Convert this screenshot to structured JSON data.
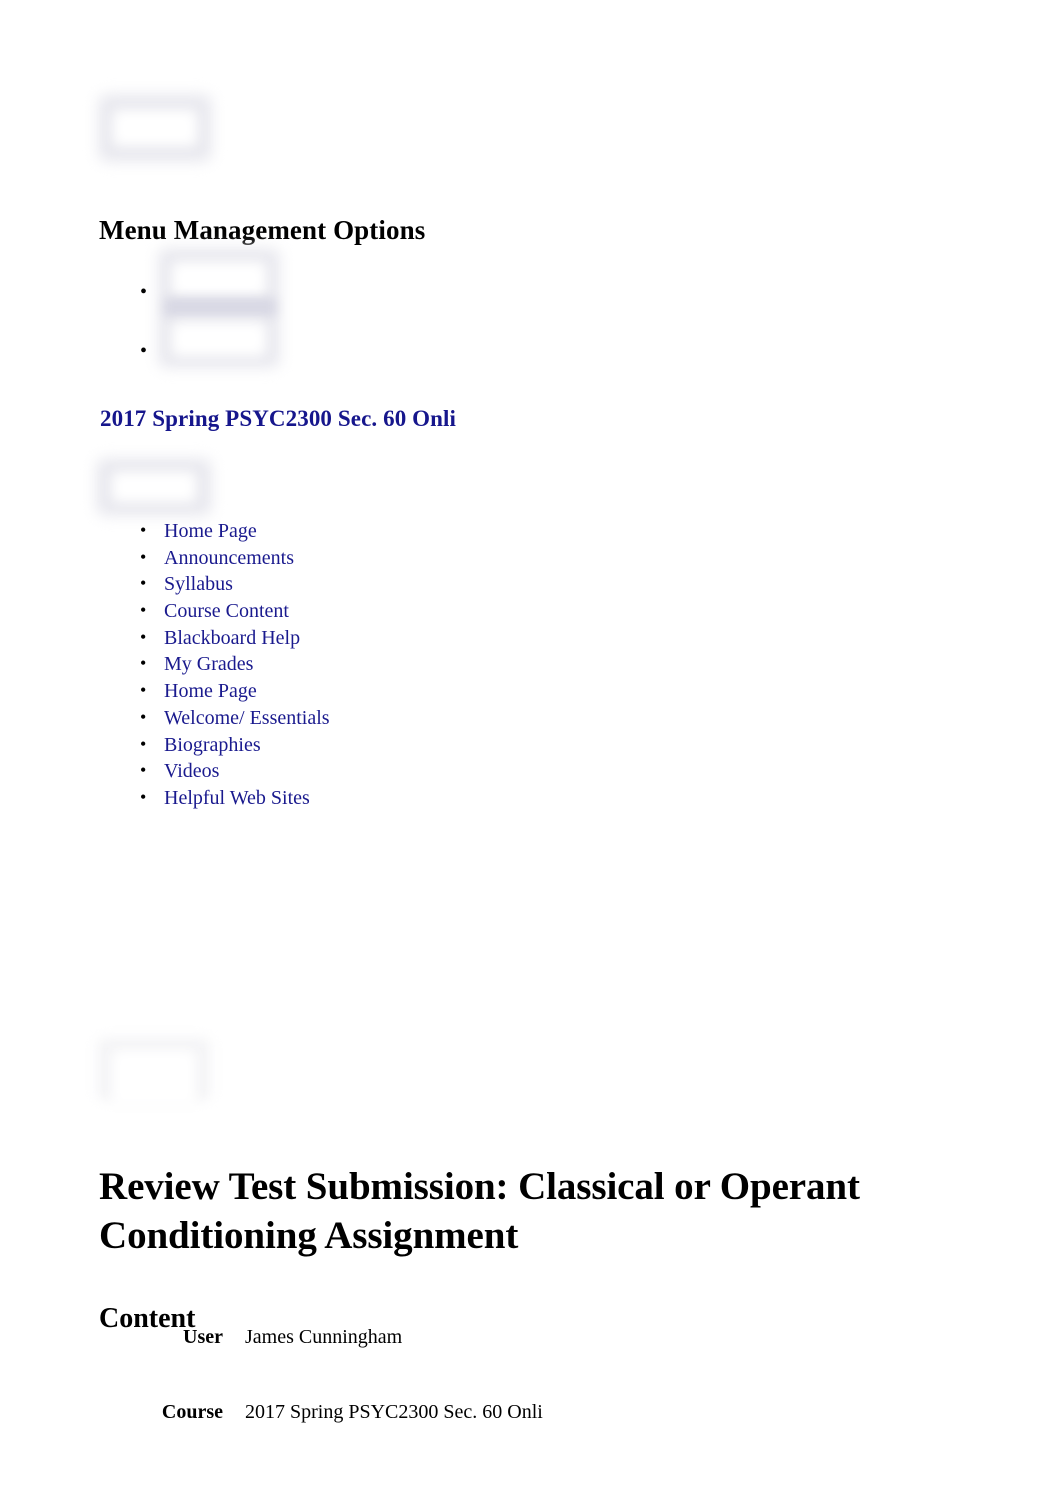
{
  "placeholders": {
    "top_block": "blurred-placeholder",
    "mid_block": "blurred-placeholder",
    "nav_block": "blurred-placeholder",
    "low_block": "blurred-placeholder"
  },
  "menu_section": {
    "heading": "Menu Management Options",
    "empty_items": [
      "",
      ""
    ]
  },
  "course": {
    "title_link": "2017 Spring PSYC2300 Sec. 60 Onli",
    "link_color": "#16168c"
  },
  "nav": {
    "link_color": "#1a1a8e",
    "items": [
      {
        "label": "Home Page"
      },
      {
        "label": "Announcements"
      },
      {
        "label": "Syllabus"
      },
      {
        "label": "Course Content"
      },
      {
        "label": "Blackboard Help"
      },
      {
        "label": "My Grades"
      },
      {
        "label": "Home Page"
      },
      {
        "label": "Welcome/ Essentials"
      },
      {
        "label": "Biographies"
      },
      {
        "label": "Videos"
      },
      {
        "label": "Helpful Web Sites"
      }
    ]
  },
  "main": {
    "title": "Review Test Submission: Classical or Operant Conditioning Assignment",
    "content_heading": "Content",
    "rows": [
      {
        "label": "User",
        "value": "James Cunningham"
      },
      {
        "label": "Course",
        "value": "2017 Spring PSYC2300 Sec. 60 Onli"
      }
    ]
  }
}
